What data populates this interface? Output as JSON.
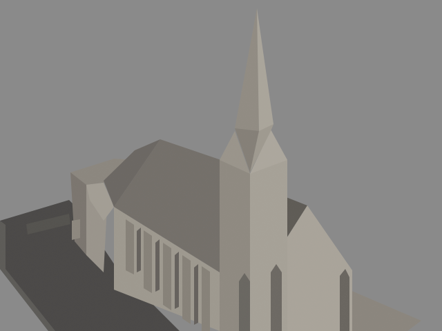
{
  "scene": {
    "subject": "church-3d-render",
    "colors": {
      "background": "#8a8a8a",
      "ground_shadow": "#4a4a4a",
      "ground_lit": "#7a7670",
      "roof_dark": "#6f6b66",
      "roof_mid": "#807b74",
      "wall_lit": "#a8a39a",
      "wall_mid": "#959087",
      "wall_shade": "#7d7870",
      "spire_lit": "#a19c92",
      "spire_shade": "#847f77",
      "recess": "#5e5a55"
    }
  }
}
